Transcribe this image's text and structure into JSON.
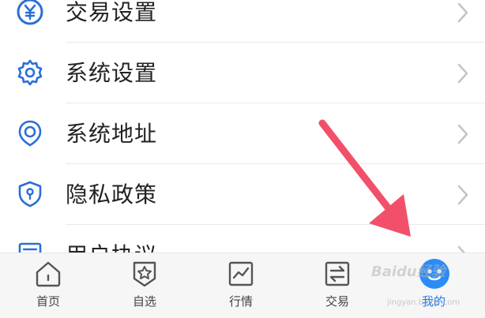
{
  "menu": {
    "items": [
      {
        "label": "交易设置",
        "icon": "yuan-circle-icon"
      },
      {
        "label": "系统设置",
        "icon": "gear-icon"
      },
      {
        "label": "系统地址",
        "icon": "location-pin-icon"
      },
      {
        "label": "隐私政策",
        "icon": "shield-icon"
      },
      {
        "label": "用户协议",
        "icon": "document-icon"
      }
    ]
  },
  "tabbar": {
    "tabs": [
      {
        "label": "首页",
        "icon": "home-icon"
      },
      {
        "label": "自选",
        "icon": "star-badge-icon"
      },
      {
        "label": "行情",
        "icon": "chart-icon"
      },
      {
        "label": "交易",
        "icon": "exchange-icon"
      },
      {
        "label": "我的",
        "icon": "profile-icon",
        "active": true
      }
    ]
  },
  "watermark": {
    "text": "Baidu经验",
    "sub": "jingyan.baidu.com"
  },
  "colors": {
    "accent": "#1d7cf2",
    "arrow": "#f2506a",
    "icon_blue": "#2a6fd6"
  }
}
